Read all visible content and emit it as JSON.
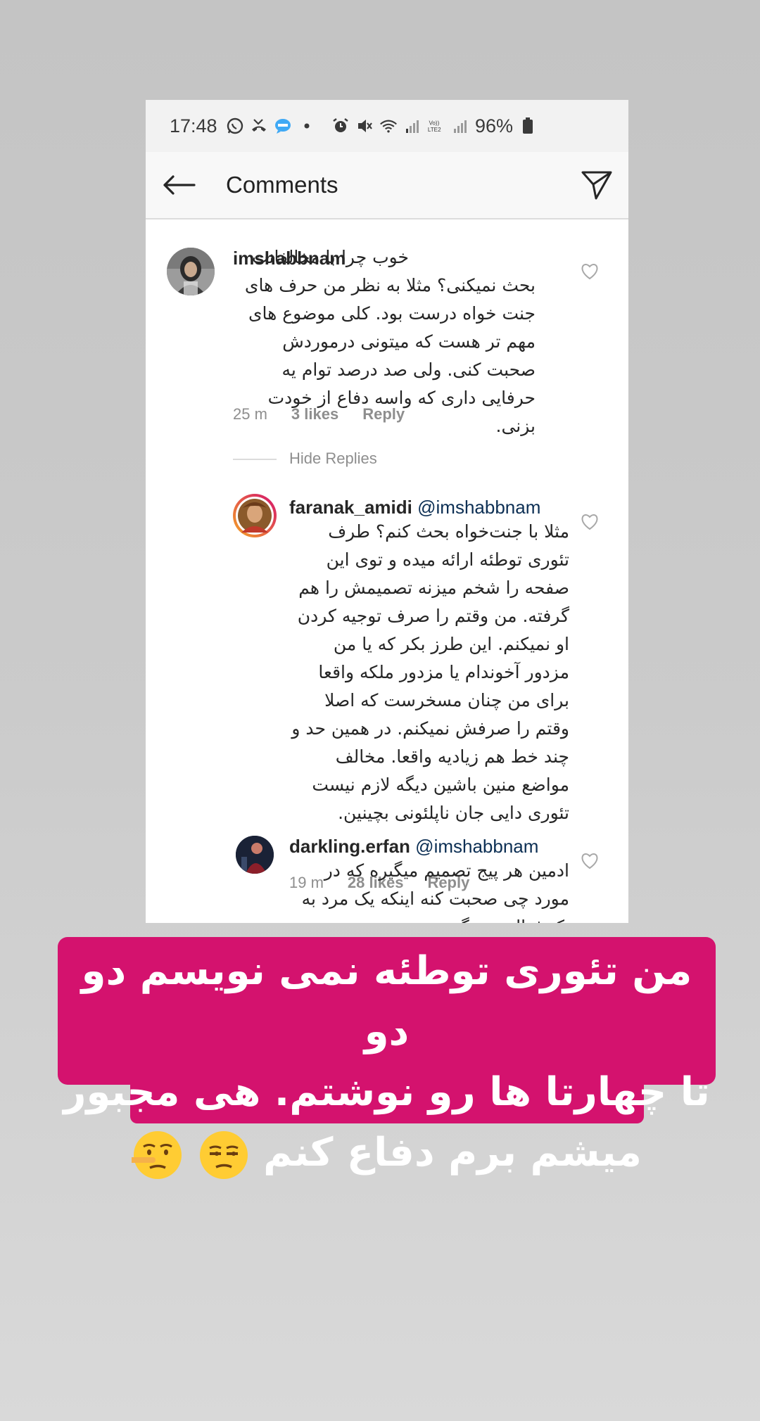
{
  "status_bar": {
    "time": "17:48",
    "battery": "96%",
    "icons": [
      "whatsapp-icon",
      "missed-call-icon",
      "imo-icon",
      "dot-icon",
      "alarm-icon",
      "mute-icon",
      "wifi-icon",
      "signal-icon",
      "volte-icon",
      "signal-icon",
      "battery-icon"
    ]
  },
  "header": {
    "title": "Comments",
    "back_icon": "arrow-left-icon",
    "share_icon": "send-icon"
  },
  "comments": [
    {
      "username": "imshabbnam",
      "text": "خوب چرا با مخالفانت بحث نمیکنی؟ مثلا به نظر من حرف های جنت خواه درست بود. کلی موضوع های مهم تر هست که میتونی درموردش صحبت کنی. ولی صد درصد توام یه حرفایی داری که واسه دفاع از خودت بزنی.",
      "time": "25 m",
      "likes": "3 likes",
      "reply": "Reply"
    }
  ],
  "hide_replies": "Hide Replies",
  "replies": [
    {
      "username": "faranak_amidi",
      "mention": "@imshabbnam",
      "text": "مثلا با جنت‌خواه بحث کنم؟ طرف تئوری توطئه ارائه میده و توی این صفحه را شخم میزنه تصمیمش را هم گرفته. من وقتم را صرف توجیه کردن او نمیکنم. این طرز بکر که یا من مزدور آخوندام یا مزدور ملکه واقعا برای من چنان مسخرست که اصلا وقتم را صرفش نمیکنم. در همین حد و چند خط هم زیادیه واقعا. مخالف مواضع منین باشین دیگه لازم نیست تئوری دایی جان ناپلئونی بچینین.",
      "time": "19 m",
      "likes": "28 likes",
      "reply": "Reply"
    },
    {
      "username": "darkling.erfan",
      "mention": "@imshabbnam",
      "text": "ادمین هر پیج تصمیم میگیره که در مورد چی صحبت کنه اینکه یک مرد به یک فعال زن بگه در مورد چی صحبت بکنه مصداق"
    }
  ],
  "banner": {
    "line1": "من تئوری توطئه نمی نویسم دو دو",
    "line2": "تا چهارتا ها رو نوشتم. هی مجبور",
    "line3": "میشم برم دفاع کنم",
    "emojis": [
      "unamused-face-emoji",
      "lying-face-emoji"
    ],
    "color": "#d4126e"
  }
}
